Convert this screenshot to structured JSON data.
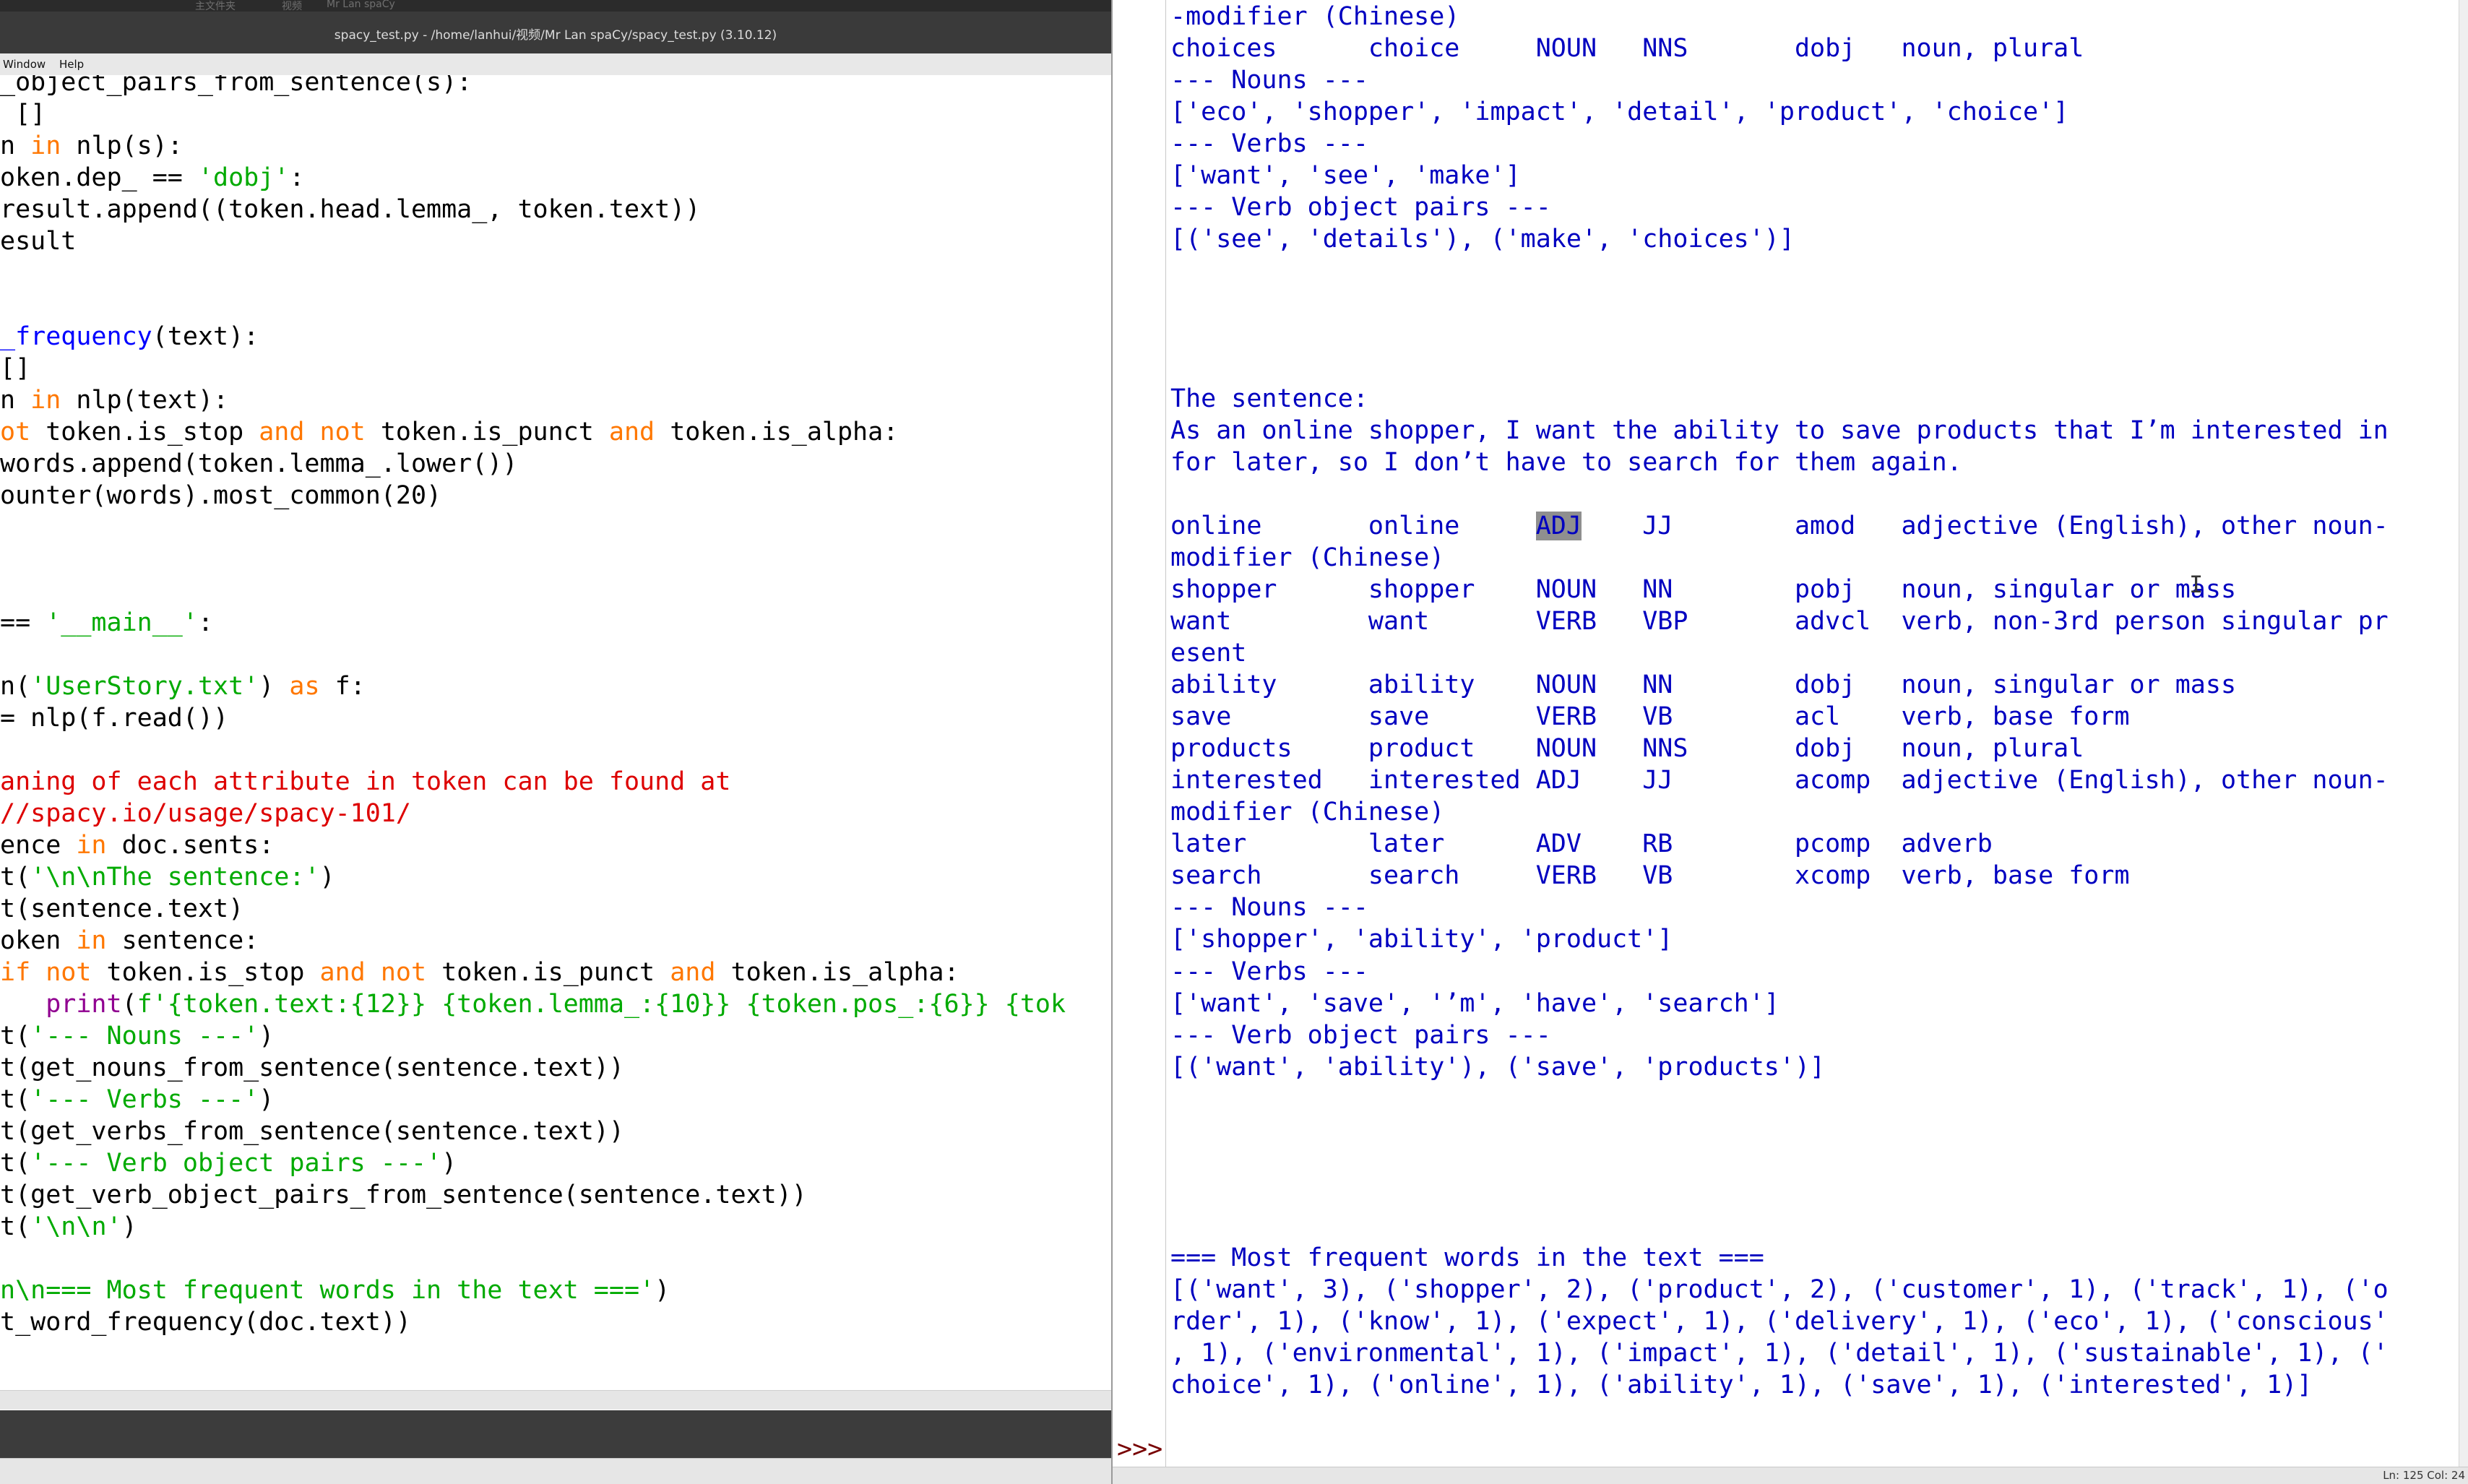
{
  "editor": {
    "breadcrumb": [
      "主文件夹",
      "视频",
      "Mr Lan spaCy"
    ],
    "title": "spacy_test.py - /home/lanhui/视频/Mr Lan spaCy/spacy_test.py (3.10.12)",
    "menus": [
      "Window",
      "Help"
    ],
    "code_lines": [
      [
        [
          "t",
          "_object_pairs_from_sentence(s):"
        ]
      ],
      [
        [
          "t",
          " []"
        ]
      ],
      [
        [
          "t",
          "n "
        ],
        [
          "kw",
          "in"
        ],
        [
          "t",
          " nlp(s):"
        ]
      ],
      [
        [
          "t",
          "oken.dep_ == "
        ],
        [
          "st",
          "'dobj'"
        ],
        [
          "t",
          ":"
        ]
      ],
      [
        [
          "t",
          "result.append((token.head.lemma_, token.text))"
        ]
      ],
      [
        [
          "t",
          "esult"
        ]
      ],
      [
        [
          "t",
          ""
        ]
      ],
      [
        [
          "t",
          ""
        ]
      ],
      [
        [
          "df",
          "_frequency"
        ],
        [
          "t",
          "(text):"
        ]
      ],
      [
        [
          "t",
          "[]"
        ]
      ],
      [
        [
          "t",
          "n "
        ],
        [
          "kw",
          "in"
        ],
        [
          "t",
          " nlp(text):"
        ]
      ],
      [
        [
          "kw",
          "ot"
        ],
        [
          "t",
          " token.is_stop "
        ],
        [
          "kw",
          "and"
        ],
        [
          "t",
          " "
        ],
        [
          "kw",
          "not"
        ],
        [
          "t",
          " token.is_punct "
        ],
        [
          "kw",
          "and"
        ],
        [
          "t",
          " token.is_alpha:"
        ]
      ],
      [
        [
          "t",
          "words.append(token.lemma_.lower())"
        ]
      ],
      [
        [
          "t",
          "ounter(words).most_common(20)"
        ]
      ],
      [
        [
          "t",
          ""
        ]
      ],
      [
        [
          "t",
          ""
        ]
      ],
      [
        [
          "t",
          ""
        ]
      ],
      [
        [
          "t",
          "== "
        ],
        [
          "st",
          "'__main__'"
        ],
        [
          "t",
          ":"
        ]
      ],
      [
        [
          "t",
          ""
        ]
      ],
      [
        [
          "t",
          "n("
        ],
        [
          "st",
          "'UserStory.txt'"
        ],
        [
          "t",
          ") "
        ],
        [
          "kw",
          "as"
        ],
        [
          "t",
          " f:"
        ]
      ],
      [
        [
          "t",
          "= nlp(f.read())"
        ]
      ],
      [
        [
          "t",
          ""
        ]
      ],
      [
        [
          "cm",
          "aning of each attribute in token can be found at"
        ]
      ],
      [
        [
          "cm",
          "//spacy.io/usage/spacy-101/"
        ]
      ],
      [
        [
          "t",
          "ence "
        ],
        [
          "kw",
          "in"
        ],
        [
          "t",
          " doc.sents:"
        ]
      ],
      [
        [
          "t",
          "t("
        ],
        [
          "st",
          "'\\n\\nThe sentence:'"
        ],
        [
          "t",
          ")"
        ]
      ],
      [
        [
          "t",
          "t(sentence.text)"
        ]
      ],
      [
        [
          "t",
          "oken "
        ],
        [
          "kw",
          "in"
        ],
        [
          "t",
          " sentence:"
        ]
      ],
      [
        [
          "kw",
          "if"
        ],
        [
          "t",
          " "
        ],
        [
          "kw",
          "not"
        ],
        [
          "t",
          " token.is_stop "
        ],
        [
          "kw",
          "and"
        ],
        [
          "t",
          " "
        ],
        [
          "kw",
          "not"
        ],
        [
          "t",
          " token.is_punct "
        ],
        [
          "kw",
          "and"
        ],
        [
          "t",
          " token.is_alpha:"
        ]
      ],
      [
        [
          "t",
          "   "
        ],
        [
          "bi",
          "print"
        ],
        [
          "t",
          "("
        ],
        [
          "st",
          "f'{token.text:{12}} {token.lemma_:{10}} {token.pos_:{6}} {tok"
        ]
      ],
      [
        [
          "t",
          "t("
        ],
        [
          "st",
          "'--- Nouns ---'"
        ],
        [
          "t",
          ")"
        ]
      ],
      [
        [
          "t",
          "t(get_nouns_from_sentence(sentence.text))"
        ]
      ],
      [
        [
          "t",
          "t("
        ],
        [
          "st",
          "'--- Verbs ---'"
        ],
        [
          "t",
          ")"
        ]
      ],
      [
        [
          "t",
          "t(get_verbs_from_sentence(sentence.text))"
        ]
      ],
      [
        [
          "t",
          "t("
        ],
        [
          "st",
          "'--- Verb object pairs ---'"
        ],
        [
          "t",
          ")"
        ]
      ],
      [
        [
          "t",
          "t(get_verb_object_pairs_from_sentence(sentence.text))"
        ]
      ],
      [
        [
          "t",
          "t("
        ],
        [
          "st",
          "'\\n\\n'"
        ],
        [
          "t",
          ")"
        ]
      ],
      [
        [
          "t",
          ""
        ]
      ],
      [
        [
          "st",
          "n\\n=== Most frequent words in the text ==="
        ],
        [
          "st",
          "'"
        ],
        [
          "t",
          ")"
        ]
      ],
      [
        [
          "t",
          "t_word_frequency(doc.text))"
        ]
      ]
    ]
  },
  "shell": {
    "output_lines": [
      "-modifier (Chinese)",
      "choices      choice     NOUN   NNS       dobj   noun, plural",
      "--- Nouns ---",
      "['eco', 'shopper', 'impact', 'detail', 'product', 'choice']",
      "--- Verbs ---",
      "['want', 'see', 'make']",
      "--- Verb object pairs ---",
      "[('see', 'details'), ('make', 'choices')]",
      "",
      "",
      "",
      "",
      "The sentence:",
      "As an online shopper, I want the ability to save products that I’m interested in",
      "for later, so I don’t have to search for them again.",
      "",
      "online       online     ADJ    JJ        amod   adjective (English), other noun-",
      "modifier (Chinese)",
      "shopper      shopper    NOUN   NN        pobj   noun, singular or mass",
      "want         want       VERB   VBP       advcl  verb, non-3rd person singular pr",
      "esent",
      "ability      ability    NOUN   NN        dobj   noun, singular or mass",
      "save         save       VERB   VB        acl    verb, base form",
      "products     product    NOUN   NNS       dobj   noun, plural",
      "interested   interested ADJ    JJ        acomp  adjective (English), other noun-",
      "modifier (Chinese)",
      "later        later      ADV    RB        pcomp  adverb",
      "search       search     VERB   VB        xcomp  verb, base form",
      "--- Nouns ---",
      "['shopper', 'ability', 'product']",
      "--- Verbs ---",
      "['want', 'save', '’m', 'have', 'search']",
      "--- Verb object pairs ---",
      "[('want', 'ability'), ('save', 'products')]",
      "",
      "",
      "",
      "",
      "",
      "=== Most frequent words in the text ===",
      "[('want', 3), ('shopper', 2), ('product', 2), ('customer', 1), ('track', 1), ('o",
      "rder', 1), ('know', 1), ('expect', 1), ('delivery', 1), ('eco', 1), ('conscious'",
      ", 1), ('environmental', 1), ('impact', 1), ('detail', 1), ('sustainable', 1), ('",
      "choice', 1), ('online', 1), ('ability', 1), ('save', 1), ('interested', 1)]"
    ],
    "highlight": {
      "line": 16,
      "text": "ADJ"
    },
    "prompt": ">>>",
    "status": "Ln: 125  Col: 24"
  }
}
